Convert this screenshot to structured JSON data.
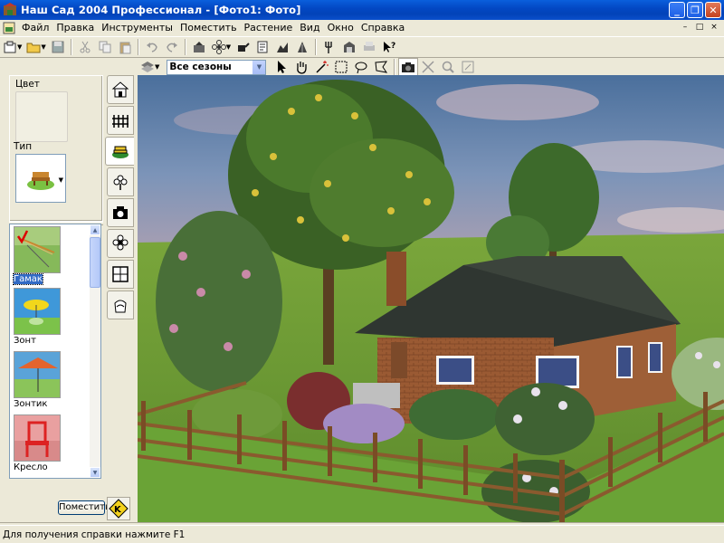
{
  "window": {
    "title": "Наш Сад 2004 Профессионал - [Фото1: Фото]",
    "controls": [
      "minimize",
      "maximize",
      "close"
    ]
  },
  "menu": {
    "items": [
      "Файл",
      "Правка",
      "Инструменты",
      "Поместить",
      "Растение",
      "Вид",
      "Окно",
      "Справка"
    ],
    "mdi_controls": [
      "–",
      "□",
      "×"
    ]
  },
  "toolbar": {
    "season_combo": "Все сезоны",
    "icons": [
      "new-object-icon",
      "open-icon",
      "save-icon",
      "cut-icon",
      "copy-icon",
      "paste-icon",
      "undo-icon",
      "redo-icon",
      "garden-tools-icon",
      "flower-icon",
      "watering-can-icon",
      "notes-icon",
      "chart-icon",
      "shovel-icon",
      "fork-icon",
      "greenhouse-icon",
      "print-icon",
      "help-cursor-icon"
    ],
    "view_icons": [
      "layers-icon",
      "pointer-icon",
      "hand-icon",
      "magic-wand-icon",
      "rect-select-icon",
      "lasso-icon",
      "polygon-select-icon",
      "camera-icon",
      "crop-icon",
      "zoom-icon",
      "resize-icon"
    ]
  },
  "left_panel": {
    "color_label": "Цвет",
    "type_label": "Тип",
    "tabs": [
      "house-tab",
      "fence-tab",
      "garden-objects-tab",
      "tree-tab",
      "camera-tab",
      "flower-tab",
      "window-tab",
      "bag-tab"
    ],
    "objects": [
      {
        "name": "Гамак",
        "selected": true
      },
      {
        "name": "Зонт",
        "selected": false
      },
      {
        "name": "Зонтик",
        "selected": false
      },
      {
        "name": "Кресло",
        "selected": false
      }
    ],
    "place_button": "Поместить"
  },
  "status": {
    "text": "Для получения справки нажмите F1"
  },
  "colors": {
    "titlebar": "#0348c4",
    "chrome": "#ece9d8",
    "selection": "#316ac5"
  }
}
